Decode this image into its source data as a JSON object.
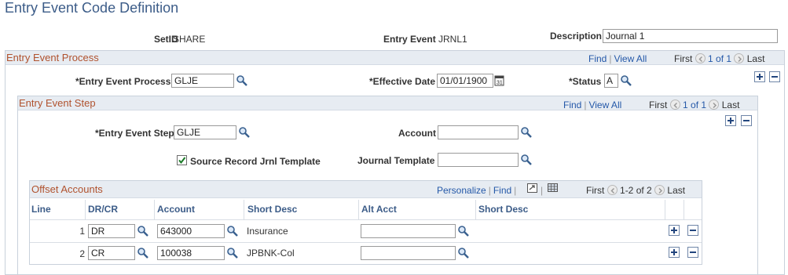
{
  "page_title": "Entry Event Code Definition",
  "header": {
    "setid_label": "SetID",
    "setid_value": "SHARE",
    "entry_event_label": "Entry Event",
    "entry_event_value": "JRNL1",
    "description_label": "Description",
    "description_value": "Journal 1"
  },
  "process_section": {
    "title": "Entry Event Process",
    "nav": {
      "find": "Find",
      "view_all": "View All",
      "first": "First",
      "range": "1 of 1",
      "last": "Last"
    },
    "entry_event_process_label": "*Entry Event Process",
    "entry_event_process_value": "GLJE",
    "effective_date_label": "*Effective Date",
    "effective_date_value": "01/01/1900",
    "status_label": "*Status",
    "status_value": "A"
  },
  "step_section": {
    "title": "Entry Event Step",
    "nav": {
      "find": "Find",
      "view_all": "View All",
      "first": "First",
      "range": "1 of 1",
      "last": "Last"
    },
    "entry_event_step_label": "*Entry Event Step",
    "entry_event_step_value": "GLJE",
    "account_label": "Account",
    "account_value": "",
    "source_record_label": "Source Record Jrnl Template",
    "source_record_checked": true,
    "journal_template_label": "Journal Template",
    "journal_template_value": ""
  },
  "offset_accounts": {
    "title": "Offset Accounts",
    "nav": {
      "personalize": "Personalize",
      "find": "Find",
      "first": "First",
      "range": "1-2 of 2",
      "last": "Last"
    },
    "columns": [
      "Line",
      "DR/CR",
      "Account",
      "Short Desc",
      "Alt Acct",
      "Short Desc"
    ],
    "rows": [
      {
        "line": "1",
        "drcr": "DR",
        "account": "643000",
        "short_desc": "Insurance",
        "alt_acct": "",
        "alt_short_desc": ""
      },
      {
        "line": "2",
        "drcr": "CR",
        "account": "100038",
        "short_desc": "JPBNK-Col",
        "alt_acct": "",
        "alt_short_desc": ""
      }
    ]
  },
  "icons": {
    "lookup": "magnifier-icon",
    "calendar": "calendar-icon",
    "add_row": "plus-icon",
    "delete_row": "minus-icon",
    "zoom": "zoom-icon",
    "download": "grid-download-icon"
  }
}
